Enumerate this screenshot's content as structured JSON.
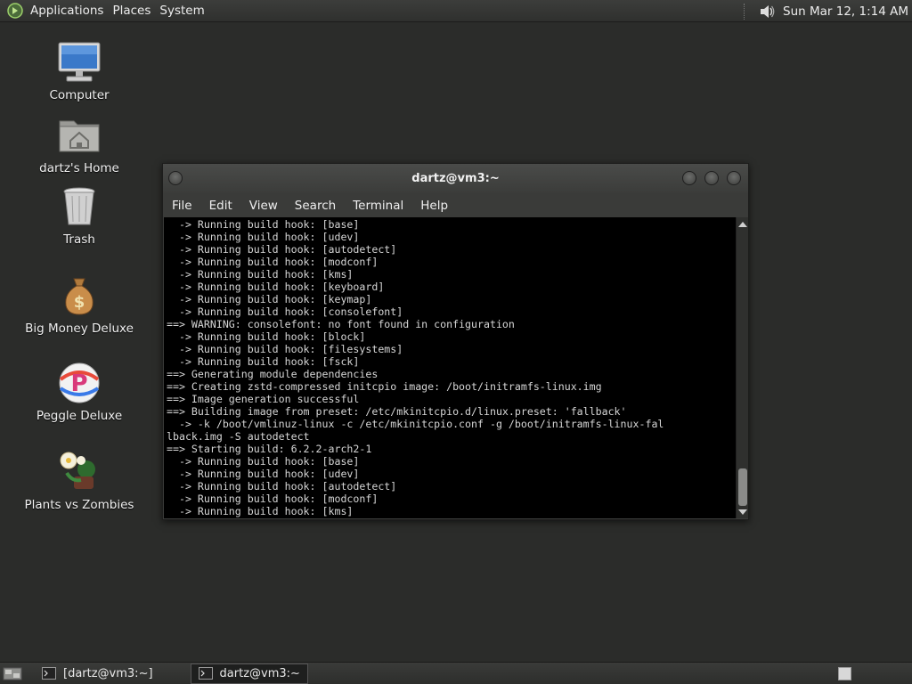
{
  "top_panel": {
    "menus": [
      "Applications",
      "Places",
      "System"
    ],
    "clock": "Sun Mar 12,  1:14 AM"
  },
  "desktop_icons": [
    {
      "label": "Computer",
      "icon": "computer-icon"
    },
    {
      "label": "dartz's Home",
      "icon": "home-folder-icon"
    },
    {
      "label": "Trash",
      "icon": "trash-icon"
    },
    {
      "label": "Big Money Deluxe",
      "icon": "money-bag-icon"
    },
    {
      "label": "Peggle Deluxe",
      "icon": "peggle-icon"
    },
    {
      "label": "Plants vs Zombies",
      "icon": "plants-vs-zombies-icon"
    }
  ],
  "terminal": {
    "title": "dartz@vm3:~",
    "menus": [
      "File",
      "Edit",
      "View",
      "Search",
      "Terminal",
      "Help"
    ],
    "lines": [
      "  -> Running build hook: [base]",
      "  -> Running build hook: [udev]",
      "  -> Running build hook: [autodetect]",
      "  -> Running build hook: [modconf]",
      "  -> Running build hook: [kms]",
      "  -> Running build hook: [keyboard]",
      "  -> Running build hook: [keymap]",
      "  -> Running build hook: [consolefont]",
      "==> WARNING: consolefont: no font found in configuration",
      "  -> Running build hook: [block]",
      "  -> Running build hook: [filesystems]",
      "  -> Running build hook: [fsck]",
      "==> Generating module dependencies",
      "==> Creating zstd-compressed initcpio image: /boot/initramfs-linux.img",
      "==> Image generation successful",
      "==> Building image from preset: /etc/mkinitcpio.d/linux.preset: 'fallback'",
      "  -> -k /boot/vmlinuz-linux -c /etc/mkinitcpio.conf -g /boot/initramfs-linux-fal",
      "lback.img -S autodetect",
      "==> Starting build: 6.2.2-arch2-1",
      "  -> Running build hook: [base]",
      "  -> Running build hook: [udev]",
      "  -> Running build hook: [autodetect]",
      "  -> Running build hook: [modconf]",
      "  -> Running build hook: [kms]"
    ]
  },
  "taskbar": {
    "tasks": [
      {
        "label": "[dartz@vm3:~]",
        "active": false
      },
      {
        "label": "dartz@vm3:~",
        "active": true
      }
    ]
  }
}
